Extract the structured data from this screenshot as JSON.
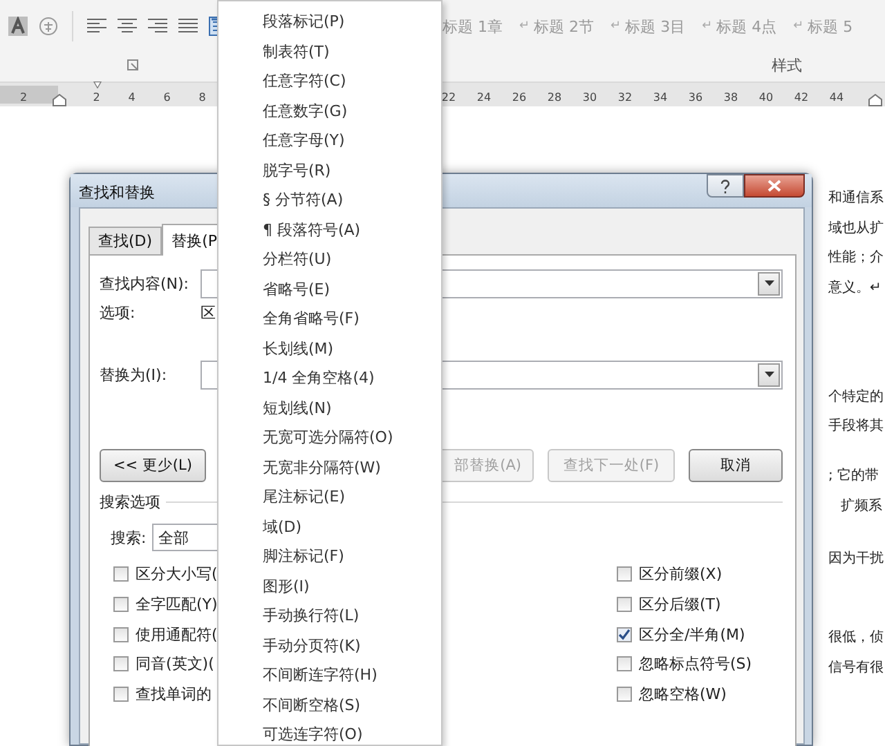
{
  "ribbon": {
    "styles": [
      {
        "label": "标题 1章"
      },
      {
        "mark": "↵",
        "label": "标题 2节"
      },
      {
        "mark": "↵",
        "label": "标题 3目"
      },
      {
        "mark": "↵",
        "label": "标题 4点"
      },
      {
        "mark": "↵",
        "label": "标题 5"
      }
    ],
    "group_label": "样式"
  },
  "ruler": {
    "left_numbers": [
      "2",
      "2",
      "4",
      "6",
      "8"
    ],
    "right_numbers": [
      "22",
      "24",
      "26",
      "28",
      "30",
      "32",
      "34",
      "36",
      "38",
      "40",
      "42",
      "44"
    ]
  },
  "document": {
    "paragraphs": [
      [
        "和通信系",
        "域也从扩",
        "性能；介",
        "意义。↵"
      ],
      [
        "个特定的",
        "手段将其"
      ],
      [
        "; 它的带",
        "扩频系"
      ],
      [
        "因为干扰"
      ],
      [
        "很低，侦",
        "信号有很"
      ]
    ]
  },
  "dialog": {
    "title": "查找和替换",
    "tabs": [
      {
        "label": "查找(D)",
        "selected": false
      },
      {
        "label": "替换(P",
        "selected": true
      }
    ],
    "find_label": "查找内容(N):",
    "options_label": "选项:",
    "options_value": "区",
    "replace_label": "替换为(I):",
    "buttons": [
      {
        "kind": "less",
        "label": "<< 更少(L)",
        "disabled": false
      },
      {
        "kind": "right",
        "label": "部替换(A)",
        "disabled": true
      },
      {
        "kind": "right",
        "label": "查找下一处(F)",
        "disabled": true
      },
      {
        "kind": "right",
        "label": "取消",
        "disabled": false
      }
    ],
    "search_options_label": "搜索选项",
    "search_label": "搜索:",
    "search_value": "全部",
    "left_checks": [
      {
        "label": "区分大小写(",
        "checked": false
      },
      {
        "label": "全字匹配(Y)",
        "checked": false
      },
      {
        "label": "使用通配符(",
        "checked": false
      },
      {
        "label": "同音(英文)(",
        "checked": false
      },
      {
        "label": "查找单词的",
        "checked": false
      }
    ],
    "right_checks": [
      {
        "label": "区分前缀(X)",
        "checked": false
      },
      {
        "label": "区分后缀(T)",
        "checked": false
      },
      {
        "label": "区分全/半角(M)",
        "checked": true
      },
      {
        "label": "忽略标点符号(S)",
        "checked": false
      },
      {
        "label": "忽略空格(W)",
        "checked": false
      }
    ]
  },
  "menu": {
    "items": [
      "段落标记(P)",
      "制表符(T)",
      "任意字符(C)",
      "任意数字(G)",
      "任意字母(Y)",
      "脱字号(R)",
      "§ 分节符(A)",
      "¶ 段落符号(A)",
      "分栏符(U)",
      "省略号(E)",
      "全角省略号(F)",
      "长划线(M)",
      "1/4 全角空格(4)",
      "短划线(N)",
      "无宽可选分隔符(O)",
      "无宽非分隔符(W)",
      "尾注标记(E)",
      "域(D)",
      "脚注标记(F)",
      "图形(I)",
      "手动换行符(L)",
      "手动分页符(K)",
      "不间断连字符(H)",
      "不间断空格(S)",
      "可选连字符(O)"
    ]
  }
}
